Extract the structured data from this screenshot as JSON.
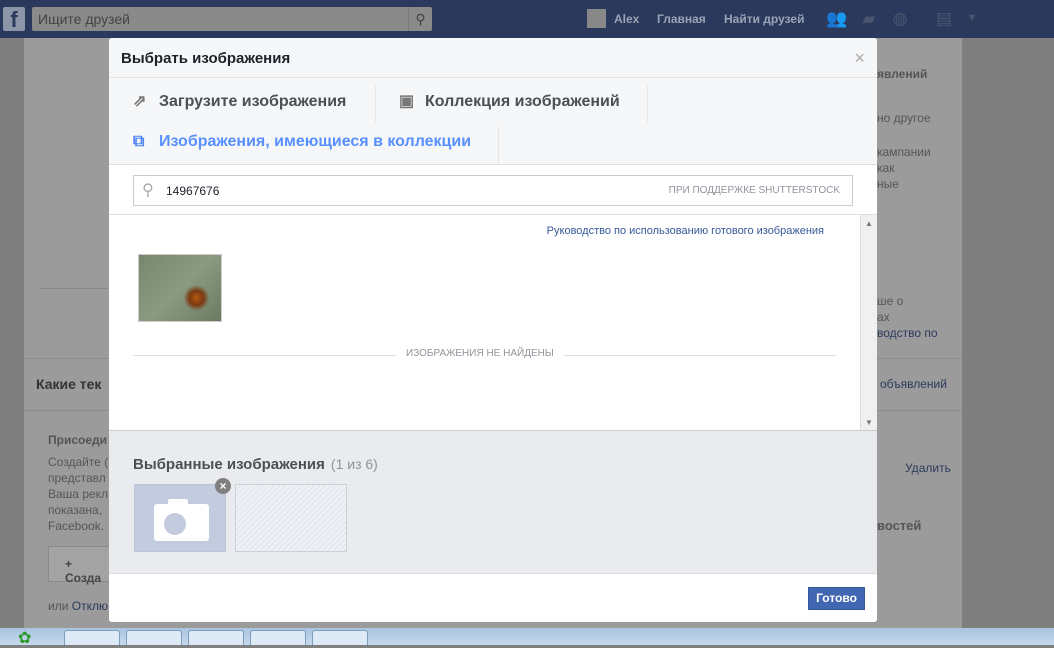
{
  "topbar": {
    "search_placeholder": "Ищите друзей",
    "user": "Alex",
    "home": "Главная",
    "find_friends": "Найти друзей"
  },
  "background": {
    "right_texts": [
      "явлений",
      "но другое",
      "кампании",
      "как",
      "ные",
      "ше о",
      "ах",
      "водство по",
      "объявлений",
      "Удалить",
      "востей"
    ],
    "heading": "Какие тек",
    "join": "Присоеди",
    "body_lines": [
      "Создайте (",
      "представл",
      "Ваша рекл",
      "показана,",
      "Facebook."
    ],
    "create_button": "+ Созда",
    "or_text": "или",
    "disable_link": "Отклю"
  },
  "modal": {
    "title": "Выбрать изображения",
    "close": "×",
    "tabs": [
      {
        "label": "Загрузите изображения",
        "icon": "upload-icon"
      },
      {
        "label": "Коллекция изображений",
        "icon": "library-icon"
      },
      {
        "label": "Изображения, имеющиеся в коллекции",
        "icon": "stock-icon",
        "active": true
      }
    ],
    "search": {
      "value": "14967676",
      "powered_by": "ПРИ ПОДДЕРЖКЕ SHUTTERSTOCK"
    },
    "guide_link": "Руководство по использованию готового изображения",
    "no_results": "ИЗОБРАЖЕНИЯ НЕ НАЙДЕНЫ",
    "selected": {
      "title": "Выбранные изображения",
      "count": "(1 из 6)"
    },
    "done_button": "Готово"
  },
  "colors": {
    "accent": "#4267b2",
    "active_tab": "#5890ff",
    "topbar": "#2b3a5c"
  }
}
